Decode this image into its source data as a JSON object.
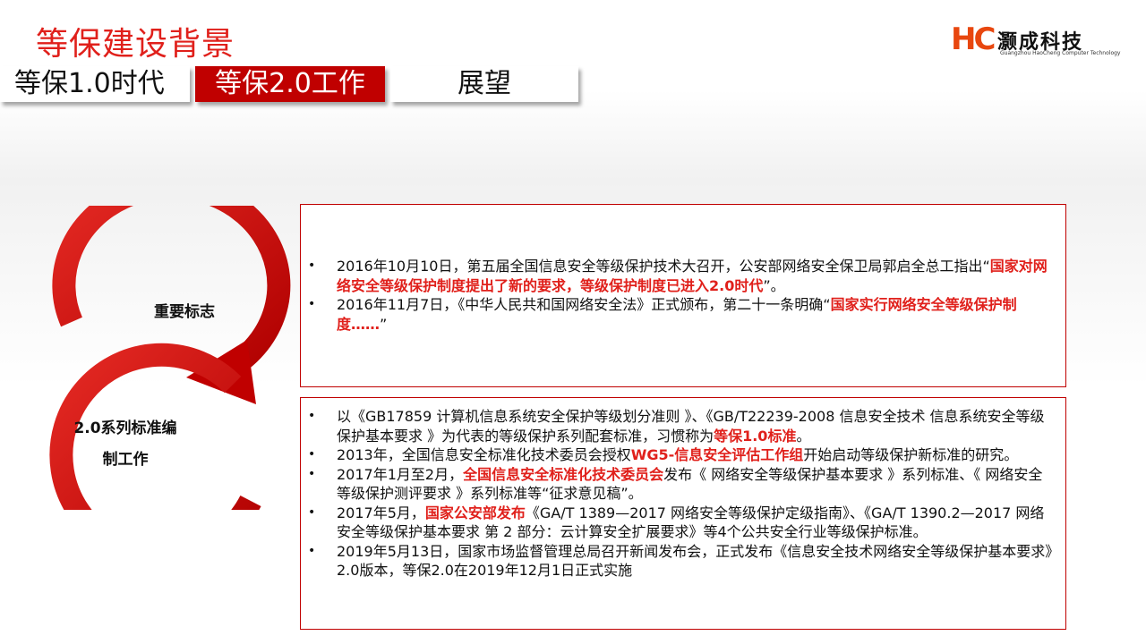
{
  "title": "等保建设背景",
  "logo": {
    "mark": "HC",
    "name": "灏成科技",
    "subtitle": "Guangzhou HaoCheng Computer Technology"
  },
  "tabs": [
    {
      "label": "等保1.0时代"
    },
    {
      "label": "等保2.0工作"
    },
    {
      "label": "展望"
    }
  ],
  "cycle": {
    "label_top": "重要标志",
    "label_bottom": "2.0系列标准编制工作"
  },
  "box1": {
    "items": [
      {
        "t1": "2016年10月10日，第五届全国信息安全等级保护技术大召开，公安部网络安全保卫局郭启全总工指出“",
        "h1": "国家对网络安全等级保护制度提出了新的要求，等级保护制度已进入2.0时代",
        "t2": "”。"
      },
      {
        "t1": "2016年11月7日，《中华人民共和国网络安全法》正式颁布，第二十一条明确“",
        "h1": "国家实行网络安全等级保护制度……",
        "t2": "”"
      }
    ]
  },
  "box2": {
    "items": [
      {
        "t1": "以《GB17859 计算机信息系统安全保护等级划分准则 》、《GB/T22239-2008 信息安全技术 信息系统安全等级保护基本要求 》为代表的等级保护系列配套标准，习惯称为",
        "h1": "等保1.0标准",
        "t2": "。"
      },
      {
        "t1": "2013年，全国信息安全标准化技术委员会授权",
        "h1": "WG5-信息安全评估工作组",
        "t2": "开始启动等级保护新标准的研究。"
      },
      {
        "t1": "2017年1月至2月，",
        "h1": "全国信息安全标准化技术委员会",
        "t2": "发布《 网络安全等级保护基本要求 》系列标准、《 网络安全等级保护测评要求 》系列标准等“征求意见稿”。"
      },
      {
        "t1": "2017年5月，",
        "h1": "国家公安部发布",
        "t2": "《GA/T 1389—2017 网络安全等级保护定级指南》、《GA/T 1390.2—2017 网络安全等级保护基本要求 第 2 部分：云计算安全扩展要求》等4个公共安全行业等级保护标准。"
      },
      {
        "t1": "2019年5月13日，国家市场监督管理总局召开新闻发布会，正式发布《信息安全技术网络安全等级保护基本要求》2.0版本，等保2.0在2019年12月1日正式实施",
        "h1": "",
        "t2": ""
      }
    ]
  },
  "colors": {
    "accent": "#e0201b",
    "tab_active": "#c00000",
    "logo": "#e8470f"
  }
}
